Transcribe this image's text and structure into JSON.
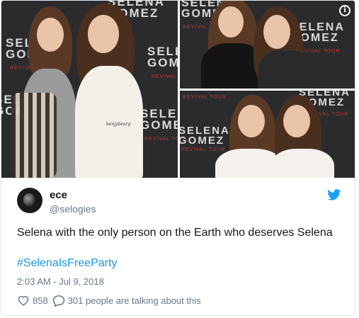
{
  "media": {
    "backdrop_line1": "SELENA",
    "backdrop_line2": "GOMEZ",
    "backdrop_sub": "REVIVAL TOUR",
    "watermark": "benjybearg"
  },
  "tweet": {
    "display_name": "ece",
    "handle": "@selogies",
    "text": "Selena with the only person on the Earth who deserves Selena",
    "hashtag": "#SelenaIsFreeParty",
    "timestamp": "2:03 AM - Jul 9, 2018",
    "likes": "858",
    "talking": "301 people are talking about this"
  },
  "colors": {
    "link": "#1b95e0",
    "muted": "#657786",
    "text": "#14171a",
    "twitter_blue": "#1da1f2"
  },
  "icons": {
    "info": "info-icon",
    "twitter": "twitter-bird-icon",
    "like": "heart-icon",
    "reply": "speech-bubble-icon"
  }
}
